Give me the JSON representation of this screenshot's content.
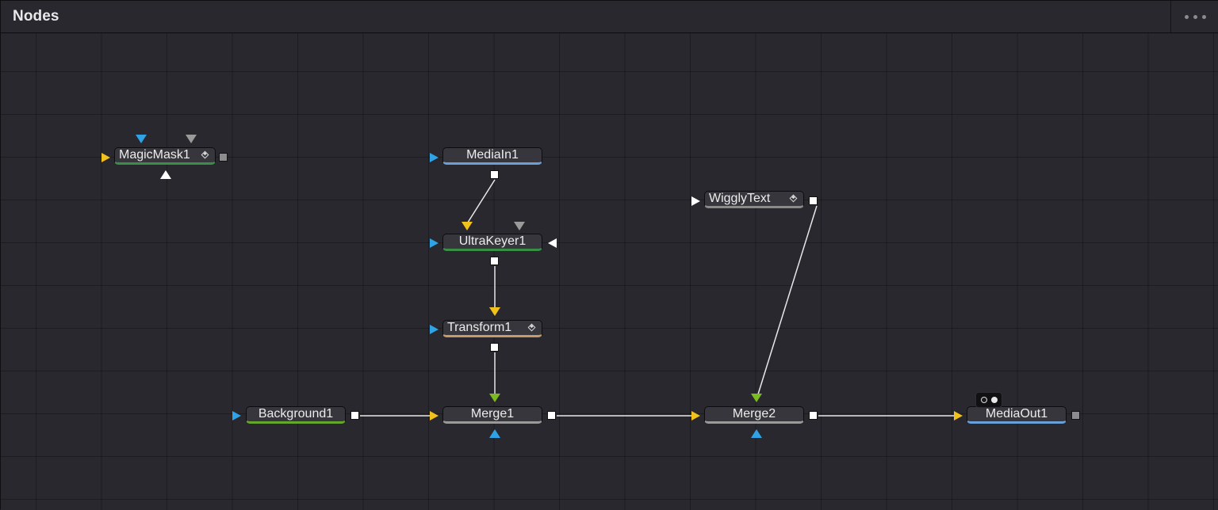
{
  "panel": {
    "title": "Nodes"
  },
  "nodes": {
    "magicmask": {
      "label": "MagicMask1",
      "color": "#3a8f47"
    },
    "mediain": {
      "label": "MediaIn1",
      "color": "#6a9fd8"
    },
    "ultrakeyer": {
      "label": "UltraKeyer1",
      "color": "#3a8f47"
    },
    "transform": {
      "label": "Transform1",
      "color": "#c79a6a"
    },
    "wigglytext": {
      "label": "WigglyText",
      "color": "#8a8a8a"
    },
    "background": {
      "label": "Background1",
      "color": "#63a82a"
    },
    "merge1": {
      "label": "Merge1",
      "color": "#9a9a9a"
    },
    "merge2": {
      "label": "Merge2",
      "color": "#9a9a9a"
    },
    "mediaout": {
      "label": "MediaOut1",
      "color": "#6a9fd8"
    }
  },
  "colors": {
    "input_yellow": "#f1c21b",
    "input_blue": "#2fa3e6",
    "input_green": "#7dba1f",
    "input_gray": "#9a9a9a",
    "input_white": "#ffffff",
    "wire": "#e8e8e8"
  }
}
